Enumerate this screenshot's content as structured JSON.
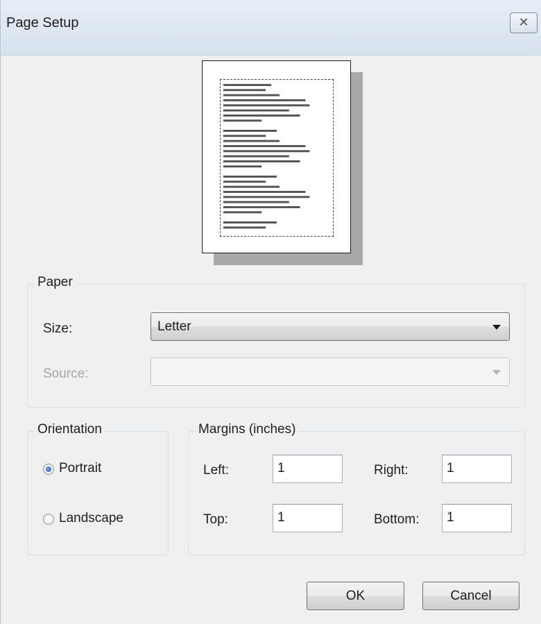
{
  "window": {
    "title": "Page Setup",
    "close_glyph": "✕"
  },
  "paper": {
    "legend": "Paper",
    "size_label": "Size:",
    "size_value": "Letter",
    "source_label": "Source:",
    "source_value": ""
  },
  "orientation": {
    "legend": "Orientation",
    "options": [
      {
        "label": "Portrait",
        "selected": true
      },
      {
        "label": "Landscape",
        "selected": false
      }
    ]
  },
  "margins": {
    "legend": "Margins (inches)",
    "left_label": "Left:",
    "left_value": "1",
    "right_label": "Right:",
    "right_value": "1",
    "top_label": "Top:",
    "top_value": "1",
    "bottom_label": "Bottom:",
    "bottom_value": "1"
  },
  "buttons": {
    "ok_label": "OK",
    "cancel_label": "Cancel"
  },
  "icons": {
    "close": "close-icon",
    "dropdown": "chevron-down-icon"
  }
}
